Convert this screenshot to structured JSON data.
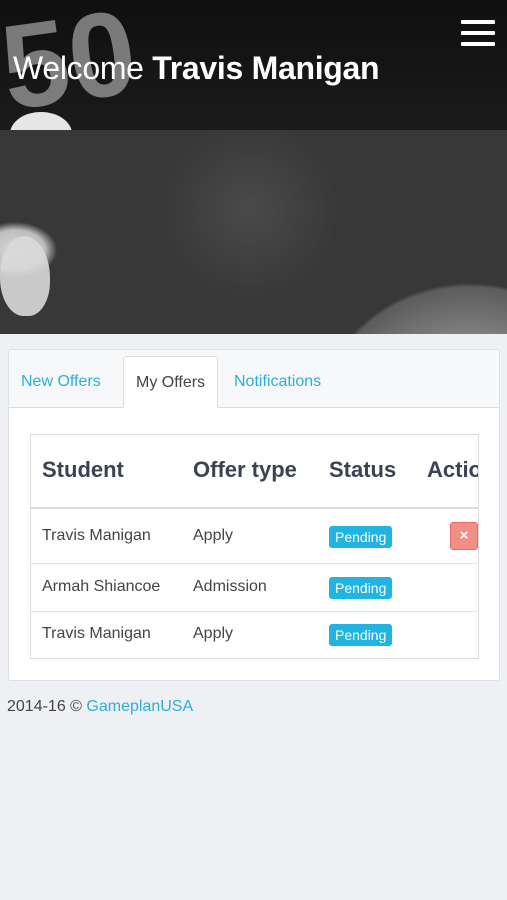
{
  "header": {
    "welcome_prefix": "Welcome",
    "user_name": "Travis Manigan",
    "menu_icon": "hamburger-menu-icon",
    "hero_decoration": "50"
  },
  "tabs": [
    {
      "label": "New Offers",
      "active": false
    },
    {
      "label": "My Offers",
      "active": true
    },
    {
      "label": "Notifications",
      "active": false
    }
  ],
  "table": {
    "columns": [
      "Student",
      "Offer type",
      "Status",
      "Actio"
    ],
    "rows": [
      {
        "student": "Travis Manigan",
        "offer_type": "Apply",
        "status": "Pending",
        "action": "×"
      },
      {
        "student": "Armah Shiancoe",
        "offer_type": "Admission",
        "status": "Pending",
        "action": ""
      },
      {
        "student": "Travis Manigan",
        "offer_type": "Apply",
        "status": "Pending",
        "action": ""
      }
    ]
  },
  "footer": {
    "copyright": "2014-16 ©",
    "link_text": "GameplanUSA"
  },
  "colors": {
    "accent": "#2bb0d8",
    "badge": "#1fb4e2",
    "delete": "#ef8f86",
    "header_bg": "#151515"
  }
}
